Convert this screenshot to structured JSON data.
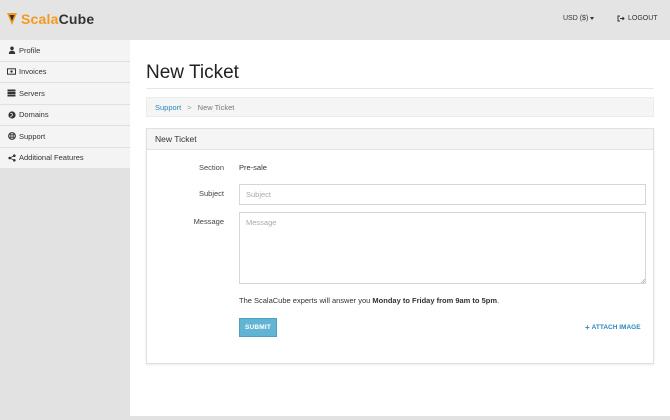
{
  "header": {
    "logo_part1": "Scala",
    "logo_part2": "Cube",
    "currency": "USD ($)",
    "logout": "LOGOUT"
  },
  "sidebar": {
    "items": [
      {
        "label": "Profile",
        "icon": "user-icon"
      },
      {
        "label": "Invoices",
        "icon": "money-icon"
      },
      {
        "label": "Servers",
        "icon": "servers-icon"
      },
      {
        "label": "Domains",
        "icon": "globe-icon"
      },
      {
        "label": "Support",
        "icon": "lifebuoy-icon"
      },
      {
        "label": "Additional Features",
        "icon": "share-icon"
      }
    ]
  },
  "main": {
    "title": "New Ticket",
    "breadcrumb": {
      "link": "Support",
      "separator": ">",
      "current": "New Ticket"
    },
    "panel": {
      "heading": "New Ticket",
      "section_label": "Section",
      "section_value": "Pre-sale",
      "subject_label": "Subject",
      "subject_placeholder": "Subject",
      "subject_value": "",
      "message_label": "Message",
      "message_placeholder": "Message",
      "message_value": "",
      "note_prefix": "The ScalaCube experts will answer you ",
      "note_bold": "Monday to Friday from 9am to 5pm",
      "note_suffix": ".",
      "submit": "SUBMIT",
      "attach": "ATTACH IMAGE"
    }
  },
  "colors": {
    "brand_orange": "#f39a1e",
    "link_blue": "#2a87bd",
    "submit_blue": "#62b4d4"
  }
}
